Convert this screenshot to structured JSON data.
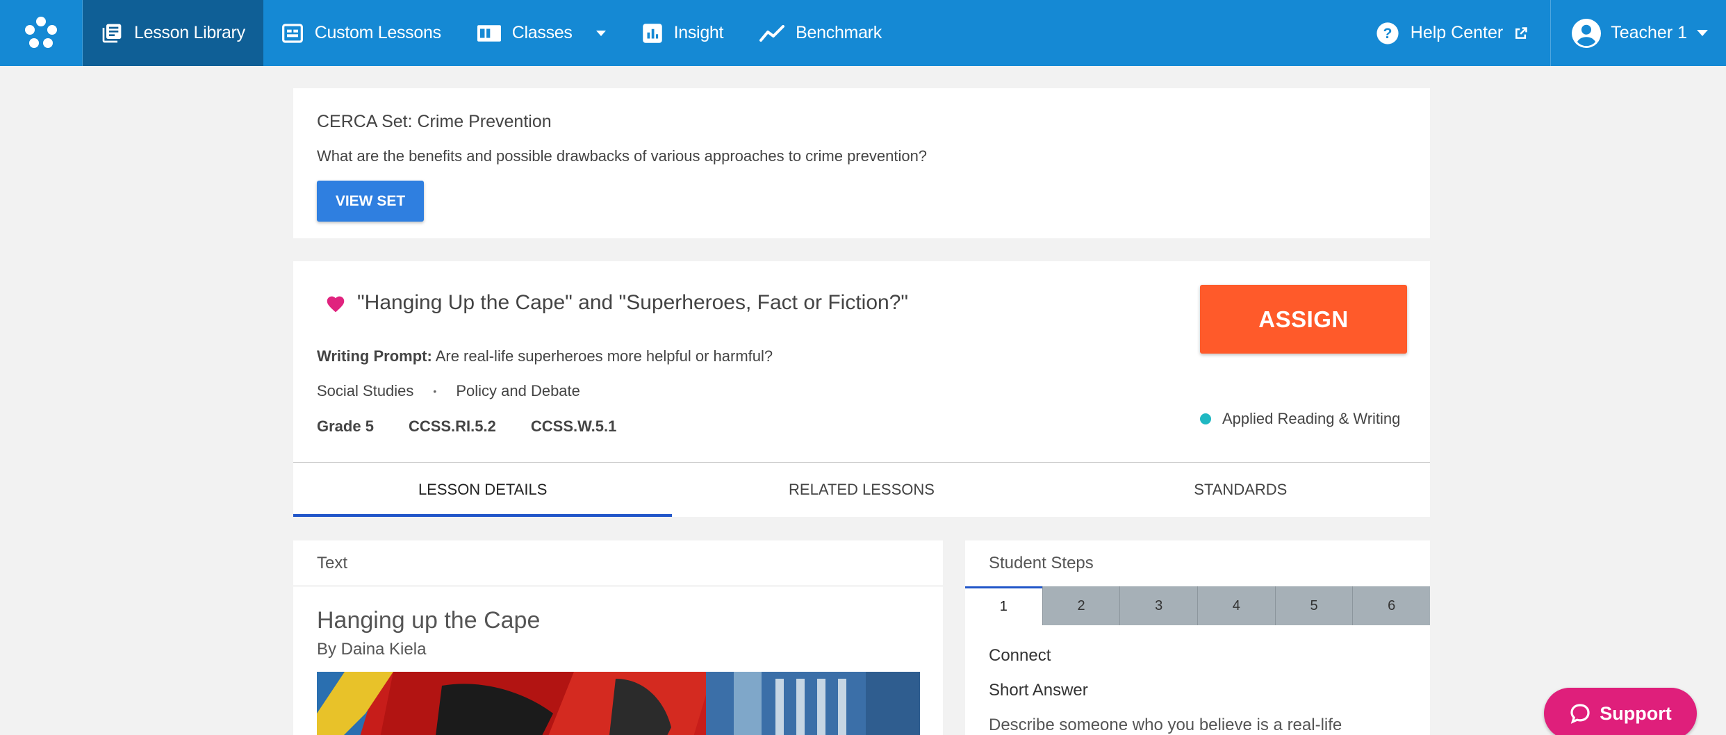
{
  "nav": {
    "items": [
      {
        "label": "Lesson Library",
        "icon": "book-stack-icon",
        "active": true
      },
      {
        "label": "Custom Lessons",
        "icon": "custom-doc-icon"
      },
      {
        "label": "Classes",
        "icon": "classes-icon",
        "dropdown": true
      },
      {
        "label": "Insight",
        "icon": "bar-chart-icon"
      },
      {
        "label": "Benchmark",
        "icon": "trend-line-icon"
      }
    ],
    "help_label": "Help Center",
    "user_label": "Teacher 1"
  },
  "set": {
    "title": "CERCA Set: Crime Prevention",
    "question": "What are the benefits and possible drawbacks of various approaches to crime prevention?",
    "button_label": "VIEW SET"
  },
  "lesson": {
    "title": "\"Hanging Up the Cape\" and \"Superheroes, Fact or Fiction?\"",
    "prompt_label": "Writing Prompt:",
    "prompt_text": " Are real-life superheroes more helpful or harmful?",
    "subject": "Social Studies",
    "separator": "•",
    "topic": "Policy and Debate",
    "grade": "Grade 5",
    "standards": [
      "CCSS.RI.5.2",
      "CCSS.W.5.1"
    ],
    "assign_label": "ASSIGN",
    "program": "Applied Reading & Writing",
    "program_color": "#1fb8c2"
  },
  "tabs": [
    {
      "label": "LESSON DETAILS",
      "active": true
    },
    {
      "label": "RELATED LESSONS"
    },
    {
      "label": "STANDARDS"
    }
  ],
  "text_panel": {
    "header": "Text",
    "story_title": "Hanging up the Cape",
    "author": "By Daina Kiela"
  },
  "steps_panel": {
    "header": "Student Steps",
    "steps": [
      "1",
      "2",
      "3",
      "4",
      "5",
      "6"
    ],
    "step_name": "Connect",
    "step_type": "Short Answer",
    "step_desc": "Describe someone who you believe is a real-life"
  },
  "support_label": "Support",
  "colors": {
    "nav_bg": "#1589d4",
    "nav_active": "#0f5f96",
    "assign": "#ff5a2a",
    "view_set": "#2f7fe0",
    "heart": "#e0237e",
    "support": "#df1f7b"
  }
}
